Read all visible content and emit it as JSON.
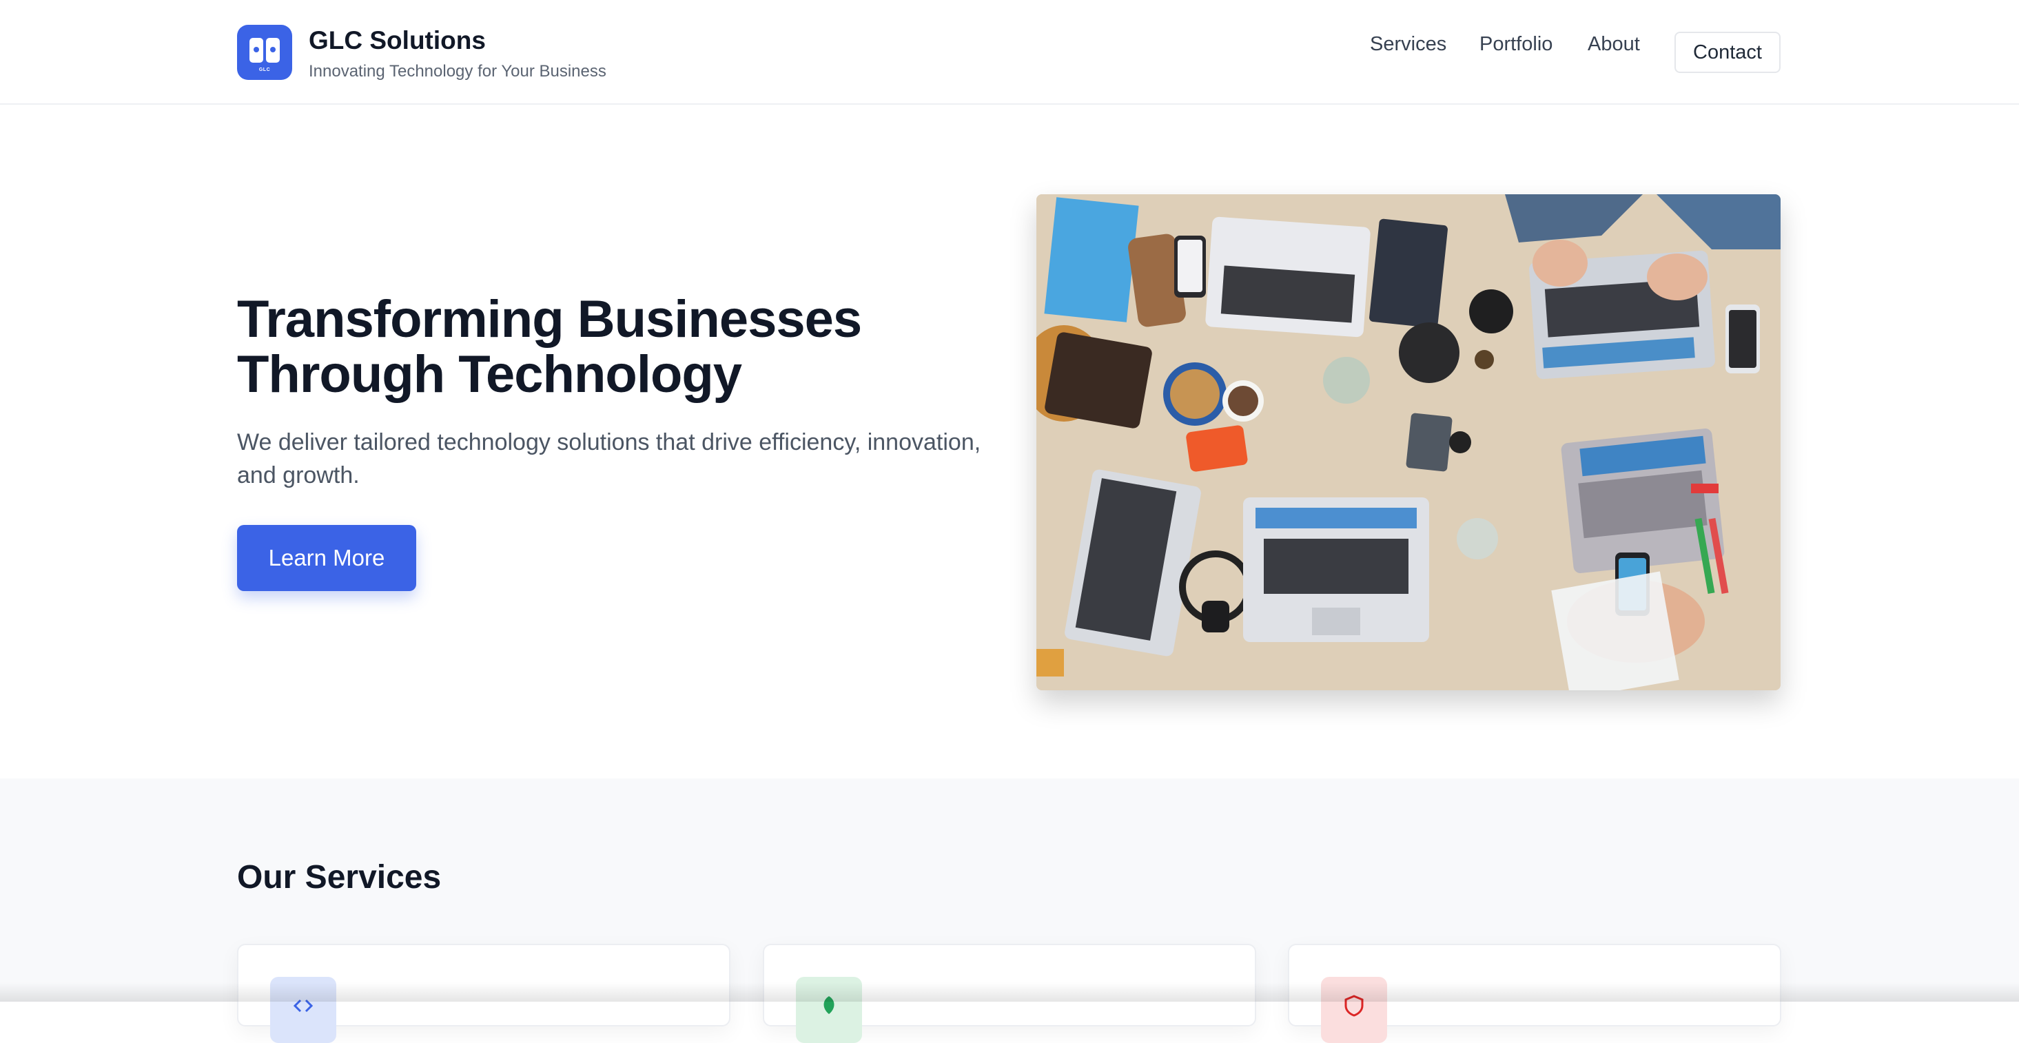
{
  "header": {
    "brand_name": "GLC Solutions",
    "brand_tagline": "Innovating Technology for Your Business",
    "logo_text": "GLC",
    "nav": [
      {
        "label": "Services"
      },
      {
        "label": "Portfolio"
      },
      {
        "label": "About"
      }
    ],
    "contact_label": "Contact"
  },
  "hero": {
    "title_line1": "Transforming Businesses",
    "title_line2": "Through Technology",
    "subtitle": "We deliver tailored technology solutions that drive efficiency, innovation, and growth.",
    "cta_label": "Learn More",
    "image_icon": "team-workspace-photo"
  },
  "services": {
    "title": "Our Services",
    "cards": [
      {
        "icon": "code-icon",
        "color": "#dbe4fb"
      },
      {
        "icon": "leaf-icon",
        "color": "#dcf2e3"
      },
      {
        "icon": "shield-icon",
        "color": "#fbdede"
      }
    ]
  },
  "colors": {
    "accent": "#3b63e6",
    "text": "#111827",
    "muted": "#4b5563"
  }
}
